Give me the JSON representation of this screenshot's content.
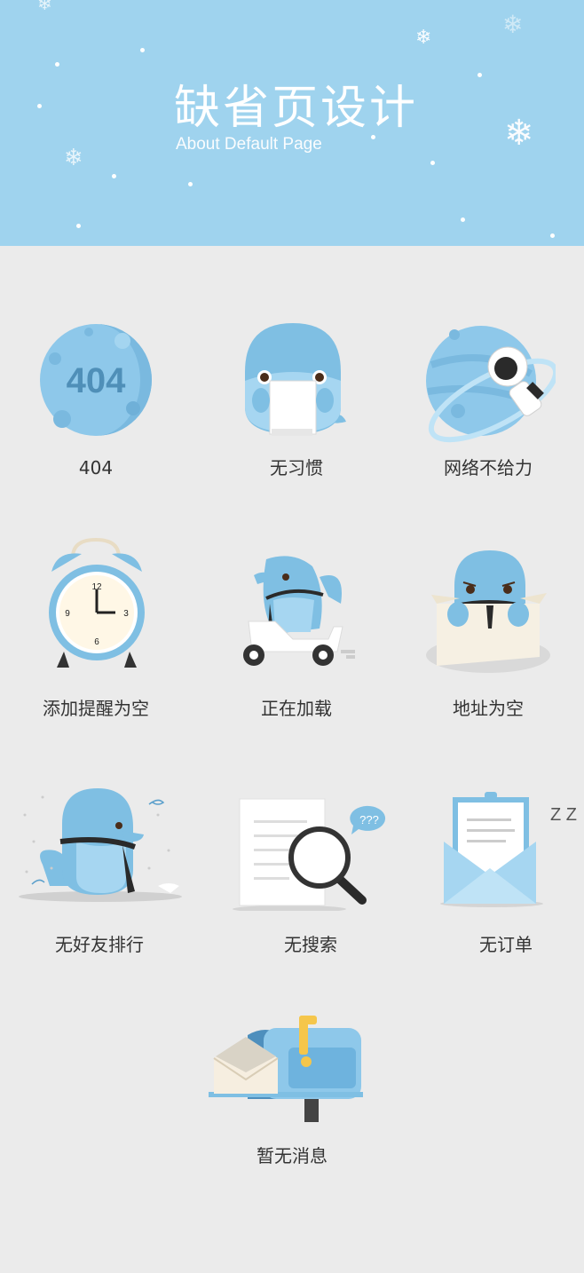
{
  "header": {
    "title": "缺省页设计",
    "subtitle": "About Default Page"
  },
  "items": [
    {
      "label": "404",
      "icon": "moon-404-icon",
      "badge": "404"
    },
    {
      "label": "无习惯",
      "icon": "dolphin-with-paper-icon"
    },
    {
      "label": "网络不给力",
      "icon": "planet-astronaut-icon"
    },
    {
      "label": "添加提醒为空",
      "icon": "alarm-clock-icon"
    },
    {
      "label": "正在加载",
      "icon": "dolphin-scooter-icon"
    },
    {
      "label": "地址为空",
      "icon": "dolphin-box-icon"
    },
    {
      "label": "无好友排行",
      "icon": "dolphin-cold-icon"
    },
    {
      "label": "无搜索",
      "icon": "magnifier-icon",
      "bubble": "???"
    },
    {
      "label": "无订单",
      "icon": "envelope-icon",
      "sleep": "Z Z"
    },
    {
      "label": "暂无消息",
      "icon": "mailbox-icon"
    }
  ],
  "colors": {
    "header_bg": "#9fd3ee",
    "page_bg": "#ebebeb",
    "illus_blue": "#7fbfe3",
    "illus_light": "#a6d6f1",
    "illus_dark": "#5a9fcb",
    "label_text": "#333333"
  }
}
